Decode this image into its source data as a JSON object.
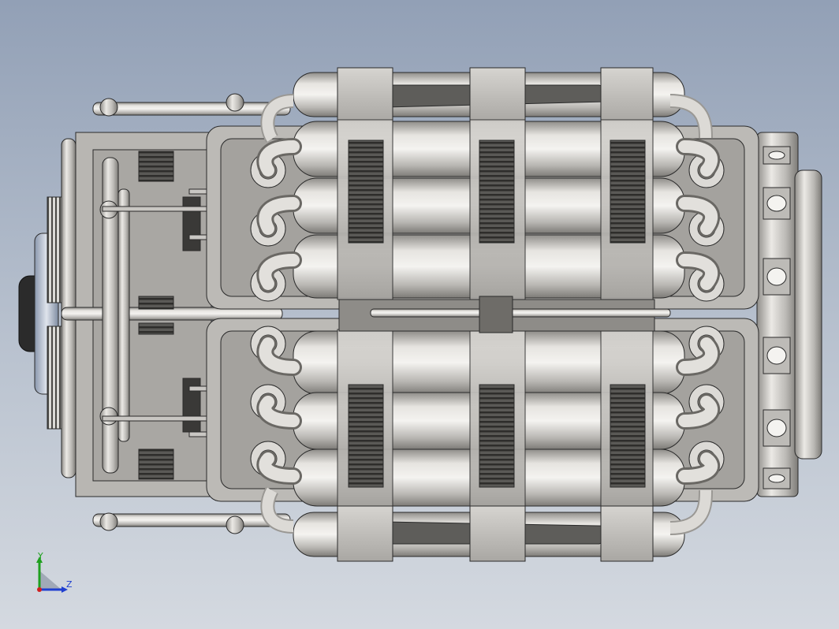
{
  "viewport": {
    "background_top": "#92a0b6",
    "background_bottom": "#d4d9e0",
    "model_fill": "#c8c6c2",
    "model_shadow": "#8a8884",
    "model_dark": "#3a3937",
    "edge_color": "#2a2a2a"
  },
  "triad": {
    "y_label": "Y",
    "z_label": "Z",
    "y_color": "#1fa01f",
    "z_color": "#1f3fd0",
    "x_color": "#d01f1f"
  }
}
